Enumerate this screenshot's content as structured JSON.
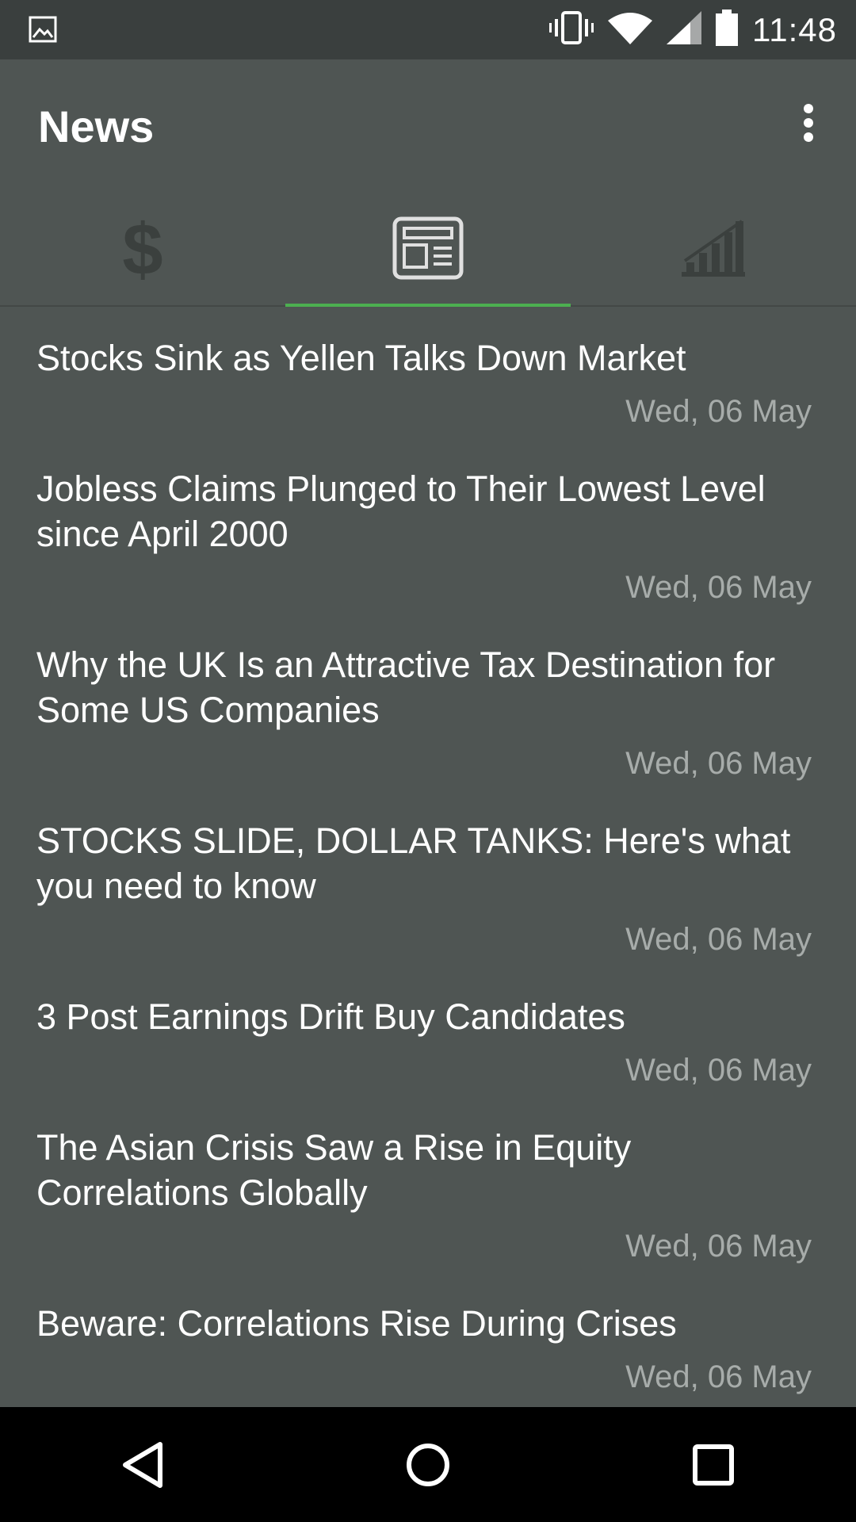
{
  "status_bar": {
    "time": "11:48",
    "icons": [
      "image-icon",
      "vibrate-icon",
      "wifi-icon",
      "signal-icon",
      "battery-icon"
    ]
  },
  "app_bar": {
    "title": "News",
    "overflow_icon": "more-vert-icon"
  },
  "tabs": [
    {
      "icon": "dollar-icon",
      "selected": false
    },
    {
      "icon": "newspaper-icon",
      "selected": true
    },
    {
      "icon": "bar-chart-icon",
      "selected": false
    }
  ],
  "news": [
    {
      "title": "Stocks Sink as Yellen Talks Down Market",
      "date": "Wed, 06 May"
    },
    {
      "title": "Jobless Claims Plunged to Their Lowest Level since April 2000",
      "date": "Wed, 06 May"
    },
    {
      "title": "Why the UK Is an Attractive Tax Destination for Some US Companies",
      "date": "Wed, 06 May"
    },
    {
      "title": "STOCKS SLIDE, DOLLAR TANKS: Here's what you need to know",
      "date": "Wed, 06 May"
    },
    {
      "title": "3 Post Earnings Drift Buy Candidates",
      "date": "Wed, 06 May"
    },
    {
      "title": "The Asian Crisis Saw a Rise in Equity Correlations Globally",
      "date": "Wed, 06 May"
    },
    {
      "title": "Beware: Correlations Rise During Crises",
      "date": "Wed, 06 May"
    }
  ],
  "nav_bar": [
    "back-icon",
    "home-icon",
    "recents-icon"
  ],
  "colors": {
    "accent": "#4caf50",
    "background": "#4f5553",
    "status_bar": "#3a3f3e",
    "date_text": "#a7acaa"
  }
}
